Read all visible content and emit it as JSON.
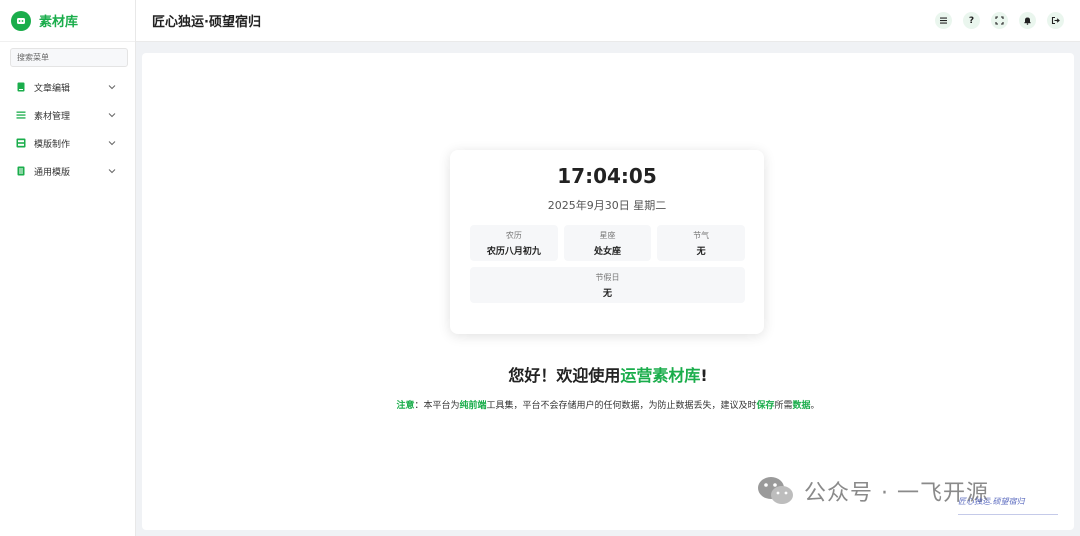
{
  "brand": {
    "name": "素材库"
  },
  "sidebar": {
    "search_placeholder": "搜索菜单",
    "items": [
      {
        "label": "文章编辑",
        "icon": "book-icon"
      },
      {
        "label": "素材管理",
        "icon": "list-icon"
      },
      {
        "label": "模版制作",
        "icon": "layout-icon"
      },
      {
        "label": "通用模版",
        "icon": "document-icon"
      }
    ]
  },
  "header": {
    "title": "匠心独运·硕望宿归",
    "actions": [
      "menu-icon",
      "help-icon",
      "fullscreen-icon",
      "bell-icon",
      "logout-icon"
    ],
    "help_glyph": "?"
  },
  "clock": {
    "time": "17:04:05",
    "date": "2025年9月30日 星期二",
    "lunar_label": "农历",
    "lunar_value": "农历八月初九",
    "zodiac_label": "星座",
    "zodiac_value": "处女座",
    "solar_term_label": "节气",
    "solar_term_value": "无",
    "holiday_label": "节假日",
    "holiday_value": "无"
  },
  "welcome": {
    "prefix": "您好！欢迎使用",
    "highlight": "运营素材库",
    "suffix": "!"
  },
  "notice": {
    "lead": "注意",
    "colon": "：本平台为",
    "pure_front": "纯前端",
    "mid1": "工具集，平台不会存储用户的任何数据，为防止数据丢失，建议及时",
    "save": "保存",
    "mid2": "所需",
    "data": "数据",
    "end": "。"
  },
  "watermark": {
    "text": "公众号 · 一飞开源",
    "signature": "匠心独运.硕望宿归"
  },
  "colors": {
    "accent": "#1aad4b",
    "background": "#f0f2f5",
    "card": "#ffffff"
  }
}
